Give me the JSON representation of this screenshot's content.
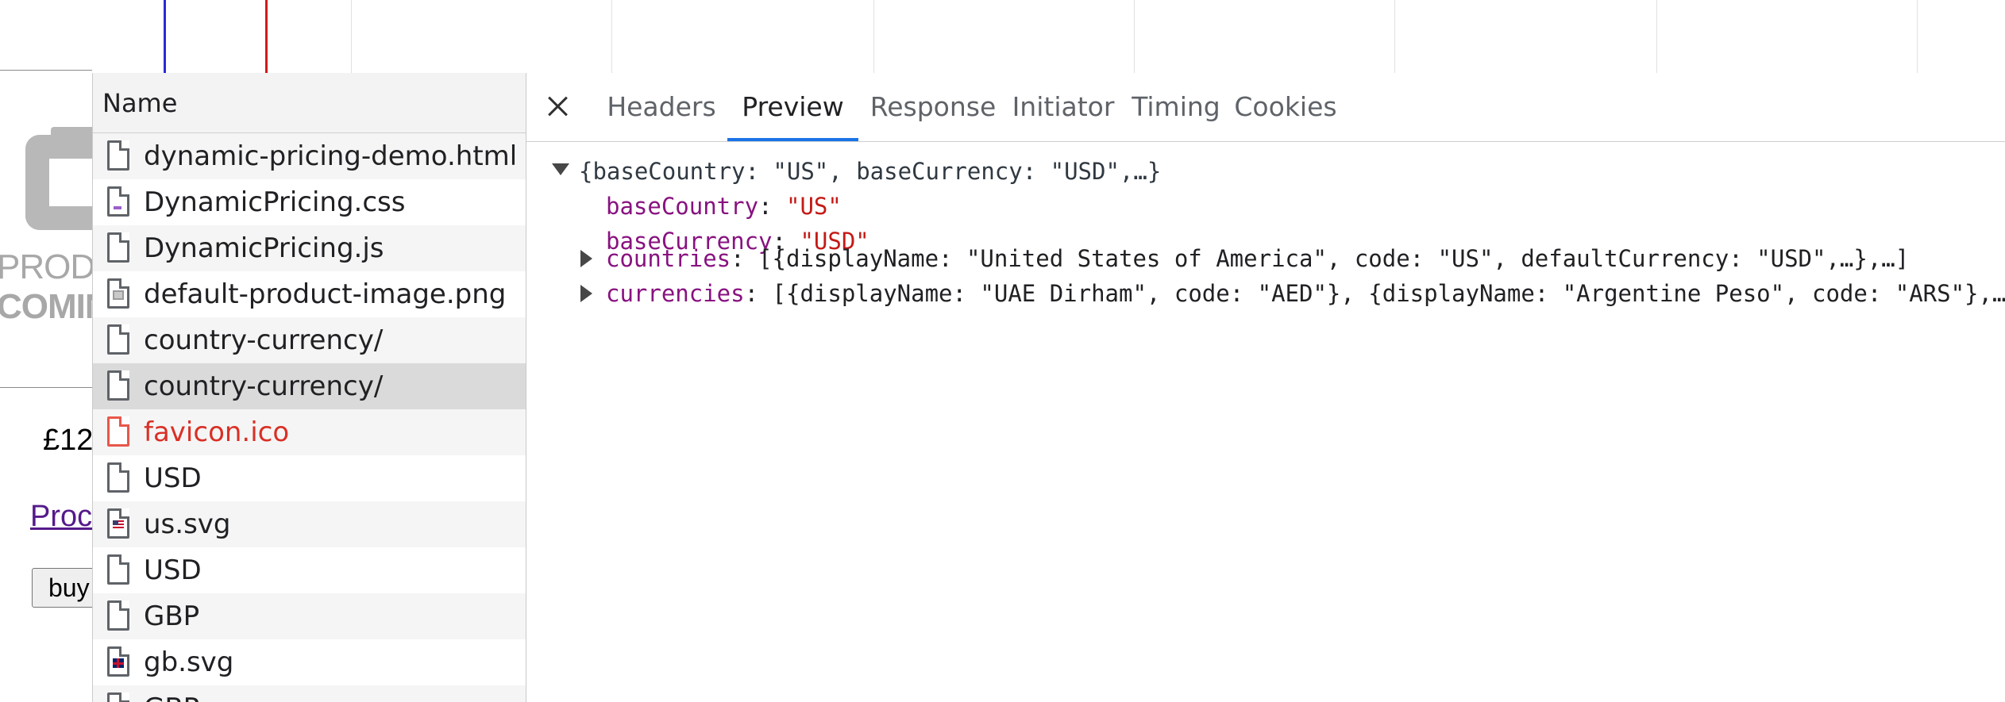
{
  "page": {
    "placeholder_line1": "PRODUC",
    "placeholder_line2": "COMIN",
    "price": "£12",
    "product_link": "Proc",
    "buy_button": "buy"
  },
  "network": {
    "list_header": "Name",
    "requests": [
      {
        "name": "dynamic-pricing-demo.html",
        "icon": "document-icon",
        "state": "normal"
      },
      {
        "name": "DynamicPricing.css",
        "icon": "css-file-icon",
        "state": "normal"
      },
      {
        "name": "DynamicPricing.js",
        "icon": "js-file-icon",
        "state": "normal"
      },
      {
        "name": "default-product-image.png",
        "icon": "image-file-icon",
        "state": "normal"
      },
      {
        "name": "country-currency/",
        "icon": "document-icon",
        "state": "normal"
      },
      {
        "name": "country-currency/",
        "icon": "document-icon",
        "state": "selected"
      },
      {
        "name": "favicon.ico",
        "icon": "document-icon",
        "state": "error"
      },
      {
        "name": "USD",
        "icon": "document-icon",
        "state": "normal"
      },
      {
        "name": "us.svg",
        "icon": "us-flag-icon",
        "state": "normal"
      },
      {
        "name": "USD",
        "icon": "document-icon",
        "state": "normal"
      },
      {
        "name": "GBP",
        "icon": "document-icon",
        "state": "normal"
      },
      {
        "name": "gb.svg",
        "icon": "gb-flag-icon",
        "state": "normal"
      },
      {
        "name": "GBP",
        "icon": "document-icon",
        "state": "normal"
      }
    ]
  },
  "details": {
    "tabs": [
      "Headers",
      "Preview",
      "Response",
      "Initiator",
      "Timing",
      "Cookies"
    ],
    "active_tab": "Preview",
    "preview": {
      "summary": "{baseCountry: \"US\", baseCurrency: \"USD\",…}",
      "baseCountry_key": "baseCountry",
      "baseCountry_value": "\"US\"",
      "baseCurrency_key": "baseCurrency",
      "baseCurrency_value": "\"USD\"",
      "countries_key": "countries",
      "countries_value": "[{displayName: \"United States of America\", code: \"US\", defaultCurrency: \"USD\",…},…]",
      "currencies_key": "currencies",
      "currencies_value": "[{displayName: \"UAE Dirham\", code: \"AED\"}, {displayName: \"Argentine Peso\", code: \"ARS\"},…]"
    }
  },
  "colors": {
    "accent": "#1a73e8",
    "key": "#881280",
    "string": "#c41a16",
    "error": "#d93025",
    "dom_content_loaded_line": "#2a2bd6",
    "load_line": "#d11a1a"
  }
}
